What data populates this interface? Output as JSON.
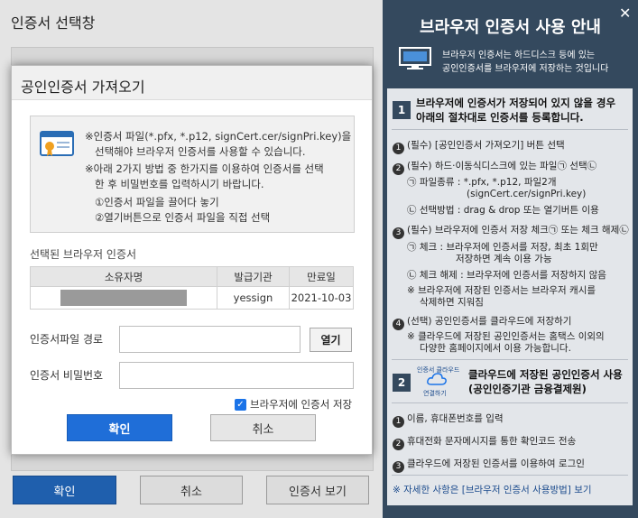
{
  "outer": {
    "title": "인증서 선택창",
    "ok": "확인",
    "cancel": "취소",
    "view": "인증서 보기"
  },
  "modal": {
    "title": "공인인증서 가져오기",
    "note1a": "※인증서 파일(*.pfx, *.p12, signCert.cer/signPri.key)을",
    "note1b": "선택해야 브라우저 인증서를 사용할 수 있습니다.",
    "note2a": "※아래 2가지 방법 중 한가지를 이용하여 인증서를 선택",
    "note2b": "한 후 비밀번호를 입력하시기 바랍니다.",
    "method1": "①인증서 파일을 끌어다 놓기",
    "method2": "②열기버튼으로 인증서 파일을 직접 선택",
    "section": "선택된 브라우저 인증서",
    "columns": [
      "소유자명",
      "발급기관",
      "만료일"
    ],
    "row": {
      "issuer": "yessign",
      "expiry": "2021-10-03"
    },
    "path_label": "인증서파일 경로",
    "open": "열기",
    "pw_label": "인증서 비밀번호",
    "save_label": "브라우저에 인증서 저장",
    "ok": "확인",
    "cancel": "취소"
  },
  "guide": {
    "title": "브라우저 인증서 사용 안내",
    "close": "✕",
    "sub1": "브라우저 인증서는 하드디스크 등에 있는",
    "sub2": "공인인증서를 브라우저에 저장하는 것입니다",
    "s1_num": "1",
    "s1_title_a": "브라우저에 인증서가 저장되어 있지 않을 경우",
    "s1_title_b": "아래의 절차대로 인증서를 등록합니다.",
    "l1": "(필수) [공인인증서 가져오기] 버튼 선택",
    "l2": "(필수) 하드·이동식디스크에 있는 파일㉠ 선택㉡",
    "l3": "㉠ 파일종류 : *.pfx, *.p12, 파일2개",
    "l4": "(signCert.cer/signPri.key)",
    "l5": "㉡ 선택방법 : drag & drop 또는 열기버튼 이용",
    "l6": "(필수) 브라우저에 인증서 저장 체크㉠ 또는 체크 해제㉡",
    "l7": "㉠ 체크 :  브라우저에 인증서를 저장, 최초 1회만",
    "l8": "저장하면 계속 이용 가능",
    "l9": "㉡ 체크 해제 : 브라우저에 인증서를 저장하지 않음",
    "l10": "※ 브라우저에 저장된 인증서는 브라우저 캐시를",
    "l11": "삭제하면 지워짐",
    "l12": "(선택) 공인인증서를 클라우드에 저장하기",
    "l13": "※ 클라우드에 저장된 공인인증서는 홈택스 이외의",
    "l14": "다양한 홈페이지에서 이용 가능합니다.",
    "s2_num": "2",
    "cloud_a": "인증서 클라우드",
    "cloud_b": "연결하기",
    "s2_title_a": "클라우드에 저장된 공인인증서 사용",
    "s2_title_b": "(공인인증기관 금융결제원)",
    "c1": "이름, 휴대폰번호를 입력",
    "c2": "휴대전화 문자메시지를 통한 확인코드 전송",
    "c3": "클라우드에 저장된 인증서를 이용하여 로그인",
    "foot": "※ 자세한 사항은 [브라우저 인증서 사용방법] 보기"
  }
}
